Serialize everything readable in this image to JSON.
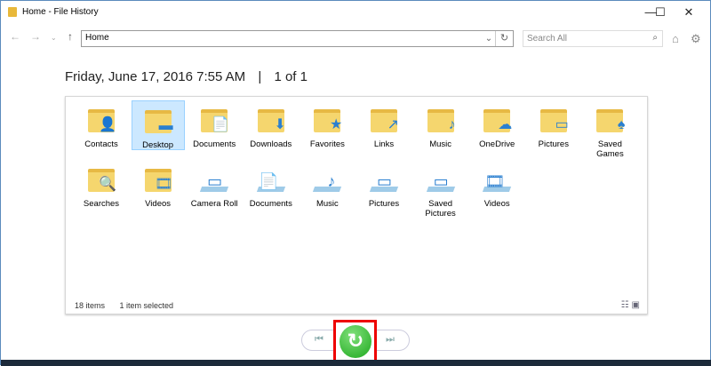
{
  "window": {
    "title": "Home - File History",
    "minimize": "—",
    "maximize": "☐",
    "close": "✕"
  },
  "toolbar": {
    "address": "Home",
    "search_placeholder": "Search All"
  },
  "header": {
    "date": "Friday, June 17, 2016 7:55 AM",
    "separator": "|",
    "page": "1 of 1"
  },
  "items": [
    {
      "label": "Contacts",
      "icon": "contacts-folder-icon",
      "kind": "folder",
      "ov": "👤"
    },
    {
      "label": "Desktop",
      "icon": "desktop-folder-icon",
      "kind": "folder",
      "ov": "▬",
      "selected": true
    },
    {
      "label": "Documents",
      "icon": "documents-folder-icon",
      "kind": "folder",
      "ov": "📄"
    },
    {
      "label": "Downloads",
      "icon": "downloads-folder-icon",
      "kind": "folder",
      "ov": "⬇"
    },
    {
      "label": "Favorites",
      "icon": "favorites-folder-icon",
      "kind": "folder",
      "ov": "★"
    },
    {
      "label": "Links",
      "icon": "links-folder-icon",
      "kind": "folder",
      "ov": "↗"
    },
    {
      "label": "Music",
      "icon": "music-folder-icon",
      "kind": "folder",
      "ov": "♪"
    },
    {
      "label": "OneDrive",
      "icon": "onedrive-folder-icon",
      "kind": "folder",
      "ov": "☁"
    },
    {
      "label": "Pictures",
      "icon": "pictures-folder-icon",
      "kind": "folder",
      "ov": "▭"
    },
    {
      "label": "Saved Games",
      "icon": "saved-games-folder-icon",
      "kind": "folder",
      "ov": "♠"
    },
    {
      "label": "Searches",
      "icon": "searches-folder-icon",
      "kind": "folder",
      "ov": "🔍"
    },
    {
      "label": "Videos",
      "icon": "videos-folder-icon",
      "kind": "folder",
      "ov": "🎞"
    },
    {
      "label": "Camera Roll",
      "icon": "camera-roll-library-icon",
      "kind": "lib",
      "ov": "▭"
    },
    {
      "label": "Documents",
      "icon": "documents-library-icon",
      "kind": "lib",
      "ov": "📄"
    },
    {
      "label": "Music",
      "icon": "music-library-icon",
      "kind": "lib",
      "ov": "♪"
    },
    {
      "label": "Pictures",
      "icon": "pictures-library-icon",
      "kind": "lib",
      "ov": "▭"
    },
    {
      "label": "Saved Pictures",
      "icon": "saved-pictures-library-icon",
      "kind": "lib",
      "ov": "▭"
    },
    {
      "label": "Videos",
      "icon": "videos-library-icon",
      "kind": "lib",
      "ov": "🎞"
    }
  ],
  "status": {
    "count": "18 items",
    "selected": "1 item selected"
  },
  "colors": {
    "accent": "#1ea81e",
    "highlight": "#e00000"
  }
}
